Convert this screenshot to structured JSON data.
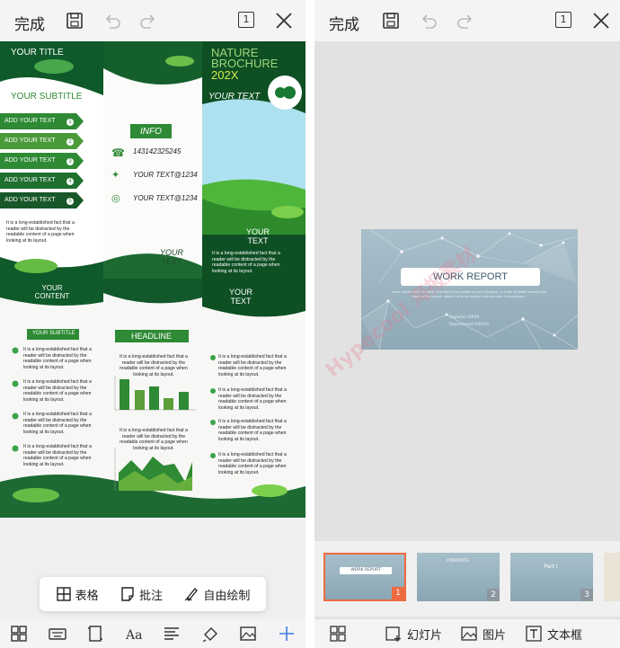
{
  "left": {
    "top_bar": {
      "done": "完成",
      "page_badge": "1"
    },
    "brochure": {
      "title": "YOUR TITLE",
      "subtitle": "YOUR SUBTITLE",
      "add_items": [
        "ADD YOUR TEXT",
        "ADD YOUR TEXT",
        "ADD YOUR TEXT",
        "ADD YOUR TEXT",
        "ADD YOUR TEXT"
      ],
      "add_nums": [
        "1",
        "2",
        "3",
        "4",
        "5"
      ],
      "lorem": "It is a long-established fact that a reader will be distracted by the readable content of a page when looking at its layout.",
      "info": "INFO",
      "phone": "143142325245",
      "twitter": "YOUR TEXT@1234",
      "instagram": "YOUR TEXT@1234",
      "nature1": "NATURE",
      "nature2": "BROCHURE",
      "year": "202X",
      "your_text": "YOUR TEXT",
      "your_text_center": "YOUR TEXT",
      "your_text_right": "YOUR TEXT",
      "your_content": "YOUR CONTENT",
      "subtitle2": "YOUR SUBTITLE",
      "headline": "HEADLINE",
      "your_text_right2": "YOUR TEXT"
    },
    "float_bar": {
      "table": "表格",
      "comment": "批注",
      "draw": "自由绘制"
    },
    "bottom_tools": [
      "layout-icon",
      "keyboard-icon",
      "frame-icon",
      "font-icon",
      "align-icon",
      "paint-icon",
      "image-icon",
      "plus-icon"
    ]
  },
  "right": {
    "top_bar": {
      "done": "完成",
      "page_badge": "1"
    },
    "slide": {
      "title": "WORK REPORT",
      "body": "Lorem ipsum dolor sit amet, the text is the wrestle of your thoughts, in order to better present the ideas of the report, please try to be concise and accurate in expression.",
      "reporter": "Reporter:XXXX",
      "department": "Department:XXXXX"
    },
    "thumbnails": [
      {
        "title": "WORK REPORT",
        "num": "1"
      },
      {
        "title": "CONTENTS",
        "num": "2"
      },
      {
        "title": "Part I",
        "num": "3"
      }
    ],
    "bottom_bar": {
      "slide": "幻灯片",
      "image": "图片",
      "textbox": "文本框"
    },
    "watermark": "Hypecool 海报素材"
  }
}
